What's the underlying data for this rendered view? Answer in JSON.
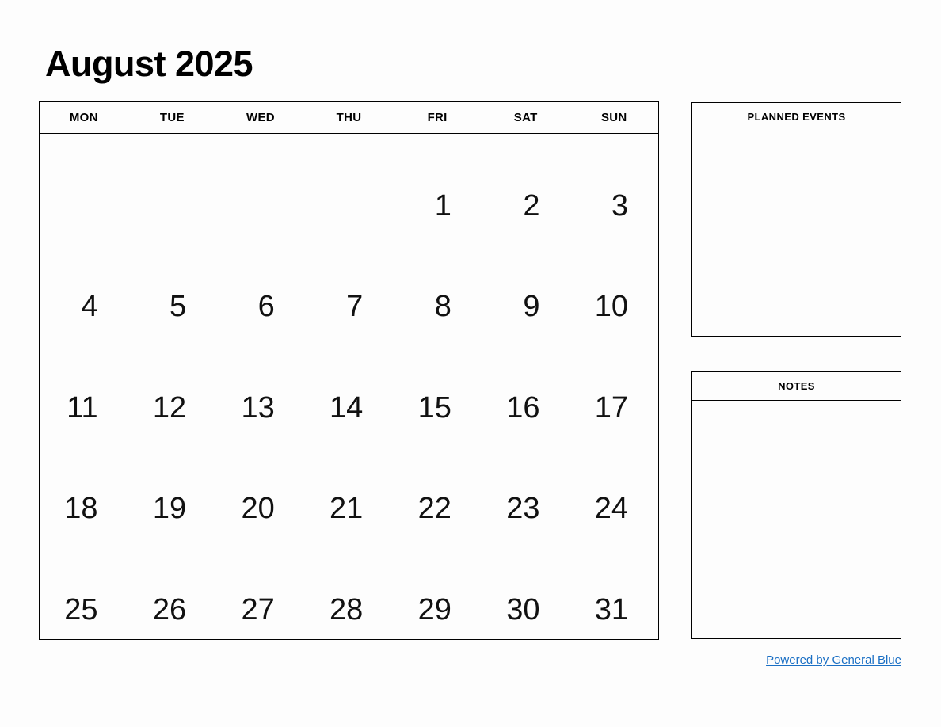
{
  "calendar": {
    "title": "August 2025",
    "month": "August",
    "year": "2025",
    "first_day_of_week": "MON",
    "weekday_headers": [
      "MON",
      "TUE",
      "WED",
      "THU",
      "FRI",
      "SAT",
      "SUN"
    ],
    "weeks": [
      [
        "",
        "",
        "",
        "",
        "1",
        "2",
        "3"
      ],
      [
        "4",
        "5",
        "6",
        "7",
        "8",
        "9",
        "10"
      ],
      [
        "11",
        "12",
        "13",
        "14",
        "15",
        "16",
        "17"
      ],
      [
        "18",
        "19",
        "20",
        "21",
        "22",
        "23",
        "24"
      ],
      [
        "25",
        "26",
        "27",
        "28",
        "29",
        "30",
        "31"
      ]
    ]
  },
  "panels": {
    "planned_events": {
      "title": "PLANNED EVENTS",
      "content": ""
    },
    "notes": {
      "title": "NOTES",
      "content": ""
    }
  },
  "footer": {
    "link_label": "Powered by General Blue"
  },
  "colors": {
    "page_background": "#fdfdfd",
    "text": "#000000",
    "border": "#000000",
    "link": "#1a6fc4"
  }
}
